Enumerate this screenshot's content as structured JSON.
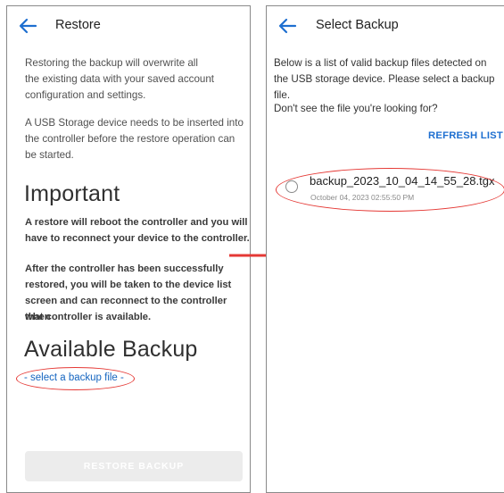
{
  "restore_screen": {
    "title": "Restore",
    "intro_line1": "Restoring the backup will overwrite all",
    "intro_line2": "the existing data with your saved account",
    "intro_line3": "configuration and settings.",
    "usb_line1": "A USB Storage device needs to be inserted into",
    "usb_line2": "the controller before the restore operation can",
    "usb_line3": "be started.",
    "important_heading": "Important",
    "reboot_line1": "A restore will reboot the controller and you will",
    "reboot_line2": "have to reconnect your device to the controller.",
    "after_line1": "After the controller has been successfully",
    "after_line2": "restored, you will be taken to the device list",
    "after_line3": "screen and can reconnect to the controller when",
    "after_line4": "that controller is available.",
    "available_heading": "Available Backup",
    "select_link": "- select a backup file -",
    "restore_button": "RESTORE BACKUP"
  },
  "select_screen": {
    "title": "Select Backup",
    "desc_line1": "Below is a list of valid backup files detected on",
    "desc_line2": "the USB storage device. Please select a backup",
    "desc_line3": "file.",
    "desc_line4": "Don't see the file you're looking for?",
    "refresh_button": "REFRESH LIST",
    "backups": [
      {
        "name": "backup_2023_10_04_14_55_28.tgx",
        "date": "October 04, 2023 02:55:50 PM",
        "selected": false
      }
    ]
  },
  "colors": {
    "accent": "#1e6fd0",
    "annotation": "#e53935"
  }
}
